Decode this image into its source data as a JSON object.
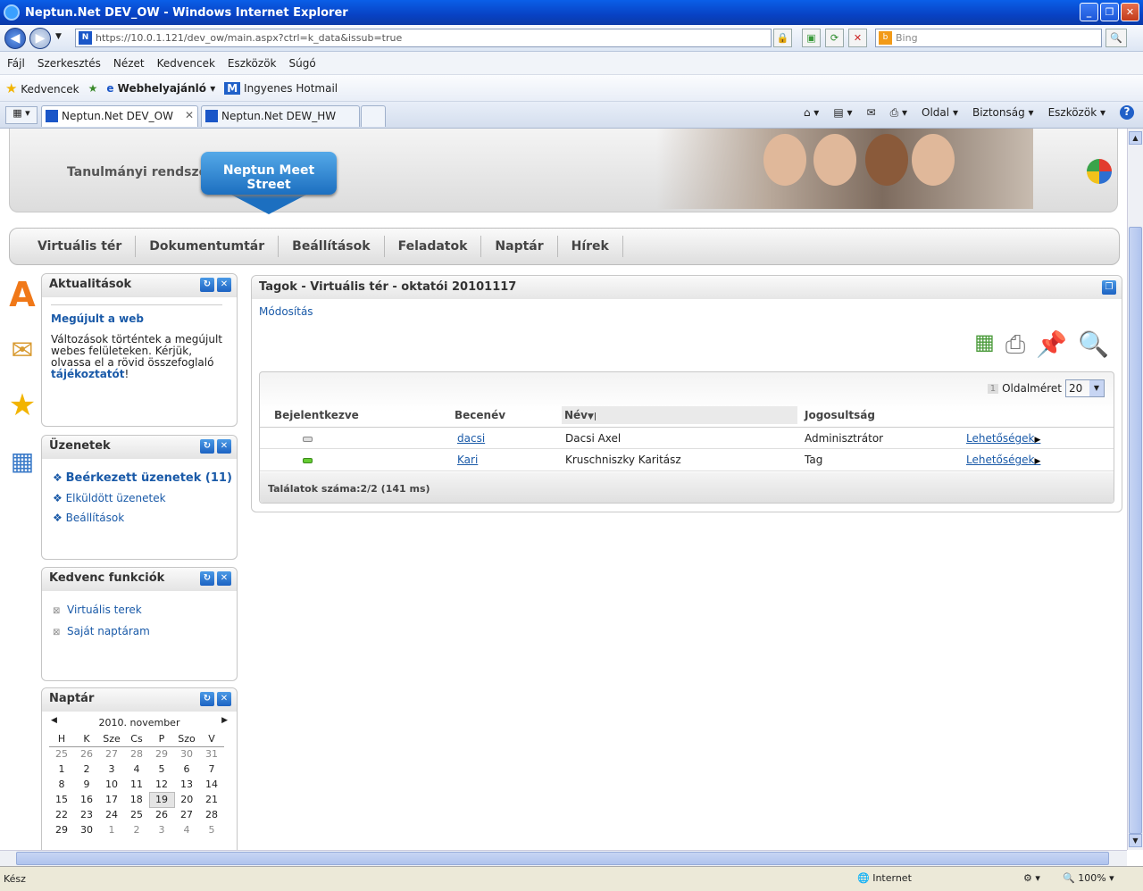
{
  "window": {
    "title": "Neptun.Net DEV_OW - Windows Internet Explorer"
  },
  "address": {
    "url": "https://10.0.1.121/dev_ow/main.aspx?ctrl=k_data&issub=true",
    "search_placeholder": "Bing"
  },
  "menu": [
    "Fájl",
    "Szerkesztés",
    "Nézet",
    "Kedvencek",
    "Eszközök",
    "Súgó"
  ],
  "favorites": {
    "label": "Kedvencek",
    "item1": "Webhelyajánló",
    "item2": "Ingyenes Hotmail"
  },
  "tabs": [
    {
      "label": "Neptun.Net DEV_OW"
    },
    {
      "label": "Neptun.Net DEW_HW"
    }
  ],
  "commands": [
    "Oldal",
    "Biztonság",
    "Eszközök"
  ],
  "header": {
    "system": "Tanulmányi rendszer",
    "meet": "Neptun Meet Street"
  },
  "nav": [
    "Virtuális tér",
    "Dokumentumtár",
    "Beállítások",
    "Feladatok",
    "Naptár",
    "Hírek"
  ],
  "news": {
    "title": "Aktualitások",
    "headline": "Megújult a web",
    "body": "Változások történtek a megújult webes felületeken. Kérjük, olvassa el a rövid összefoglaló ",
    "link": "tájékoztatót",
    "end": "!"
  },
  "messages": {
    "title": "Üzenetek",
    "items": [
      "Beérkezett üzenetek (11)",
      "Elküldött üzenetek",
      "Beállítások"
    ]
  },
  "favfunc": {
    "title": "Kedvenc funkciók",
    "items": [
      "Virtuális terek",
      "Saját naptáram"
    ]
  },
  "calendar": {
    "title": "Naptár",
    "month": "2010. november",
    "days": [
      "H",
      "K",
      "Sze",
      "Cs",
      "P",
      "Szo",
      "V"
    ],
    "weeks": [
      [
        "25",
        "26",
        "27",
        "28",
        "29",
        "30",
        "31"
      ],
      [
        "1",
        "2",
        "3",
        "4",
        "5",
        "6",
        "7"
      ],
      [
        "8",
        "9",
        "10",
        "11",
        "12",
        "13",
        "14"
      ],
      [
        "15",
        "16",
        "17",
        "18",
        "19",
        "20",
        "21"
      ],
      [
        "22",
        "23",
        "24",
        "25",
        "26",
        "27",
        "28"
      ],
      [
        "29",
        "30",
        "1",
        "2",
        "3",
        "4",
        "5"
      ]
    ]
  },
  "panel": {
    "title": "Tagok - Virtuális tér - oktatói 20101117",
    "modify": "Módosítás",
    "page_num": "1",
    "page_size_label": "Oldalméret",
    "page_size": "20",
    "columns": [
      "Bejelentkezve",
      "Becenév",
      "Név",
      "Jogosultság"
    ],
    "rows": [
      {
        "nick": "dacsi",
        "name": "Dacsi Axel",
        "role": "Adminisztrátor",
        "action": "Lehetőségek",
        "online": false
      },
      {
        "nick": "Kari",
        "name": "Kruschniszky Karitász",
        "role": "Tag",
        "action": "Lehetőségek",
        "online": true
      }
    ],
    "footer": "Találatok száma:2/2 (141 ms)"
  },
  "status": {
    "left": "Kész",
    "zone": "Internet",
    "zoom": "100%"
  },
  "colors": {
    "accent": "#1a5aa8",
    "online": "#66cc33",
    "offline": "#e0e0e0"
  }
}
